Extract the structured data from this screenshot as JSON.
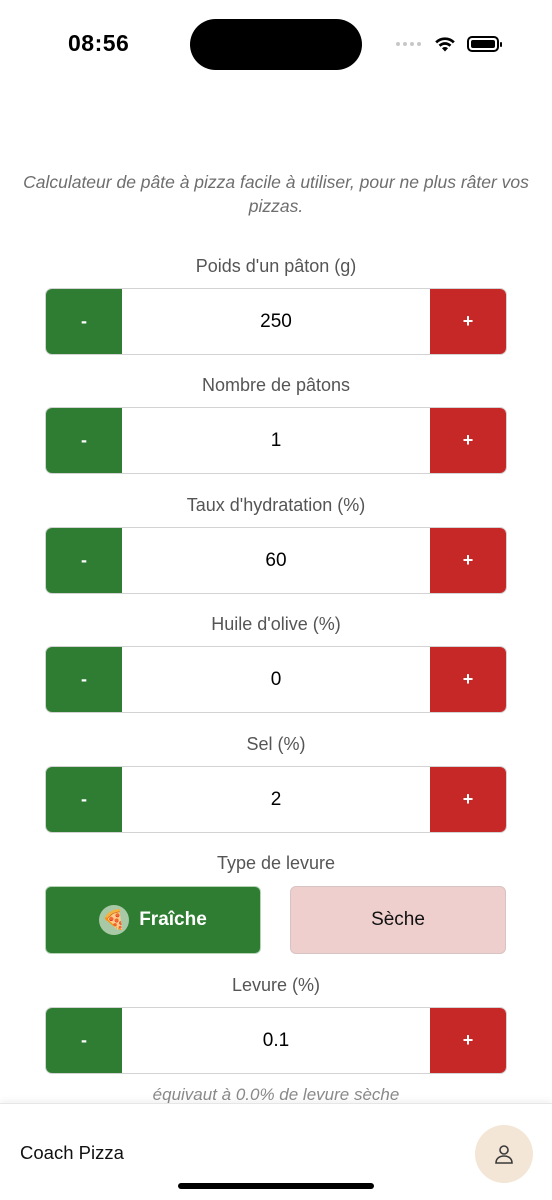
{
  "status_bar": {
    "time": "08:56"
  },
  "subtitle": "Calculateur de pâte à pizza facile à utiliser, pour ne plus râter vos pizzas.",
  "fields": [
    {
      "label": "Poids d'un pâton (g)",
      "value": "250",
      "minus": "-",
      "plus": "+"
    },
    {
      "label": "Nombre de pâtons",
      "value": "1",
      "minus": "-",
      "plus": "+"
    },
    {
      "label": "Taux d'hydratation (%)",
      "value": "60",
      "minus": "-",
      "plus": "+"
    },
    {
      "label": "Huile d'olive (%)",
      "value": "0",
      "minus": "-",
      "plus": "+"
    },
    {
      "label": "Sel (%)",
      "value": "2",
      "minus": "-",
      "plus": "+"
    }
  ],
  "yeast_type": {
    "label": "Type de levure",
    "options": [
      "Fraîche",
      "Sèche"
    ],
    "selected": "Fraîche",
    "selected_icon": "🍕"
  },
  "yeast": {
    "label": "Levure (%)",
    "value": "0.1",
    "minus": "-",
    "plus": "+"
  },
  "equivalence": "équivaut à 0.0% de levure sèche",
  "bottom_bar": {
    "app_name": "Coach Pizza",
    "profile_icon": "user-icon"
  },
  "colors": {
    "green": "#2e7d32",
    "red": "#c62828",
    "dry_bg": "#efcfcd",
    "profile_bg": "#f3e6d6"
  }
}
